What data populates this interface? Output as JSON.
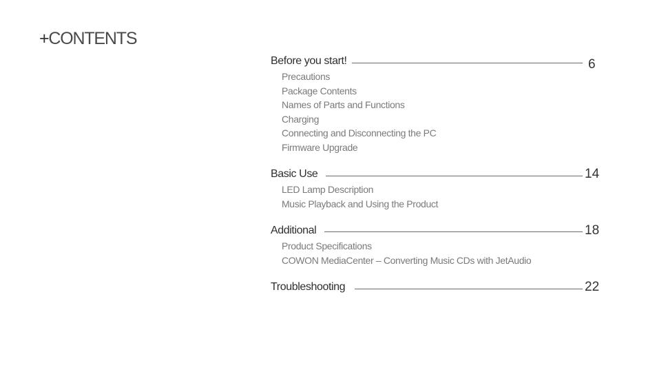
{
  "title": {
    "prefix": "+",
    "text": "CONTENTS"
  },
  "toc": {
    "sections": [
      {
        "heading": "Before you start!",
        "page": "6",
        "items": [
          "Precautions",
          "Package Contents",
          "Names of Parts and Functions",
          "Charging",
          "Connecting and Disconnecting the PC",
          "Firmware Upgrade"
        ]
      },
      {
        "heading": "Basic Use",
        "page": "14",
        "items": [
          "LED Lamp Description",
          "Music Playback and Using the Product"
        ]
      },
      {
        "heading": "Additional",
        "page": "18",
        "items": [
          "Product Specifications",
          "COWON MediaCenter – Converting Music CDs with JetAudio"
        ]
      },
      {
        "heading": "Troubleshooting",
        "page": "22",
        "items": []
      }
    ]
  }
}
